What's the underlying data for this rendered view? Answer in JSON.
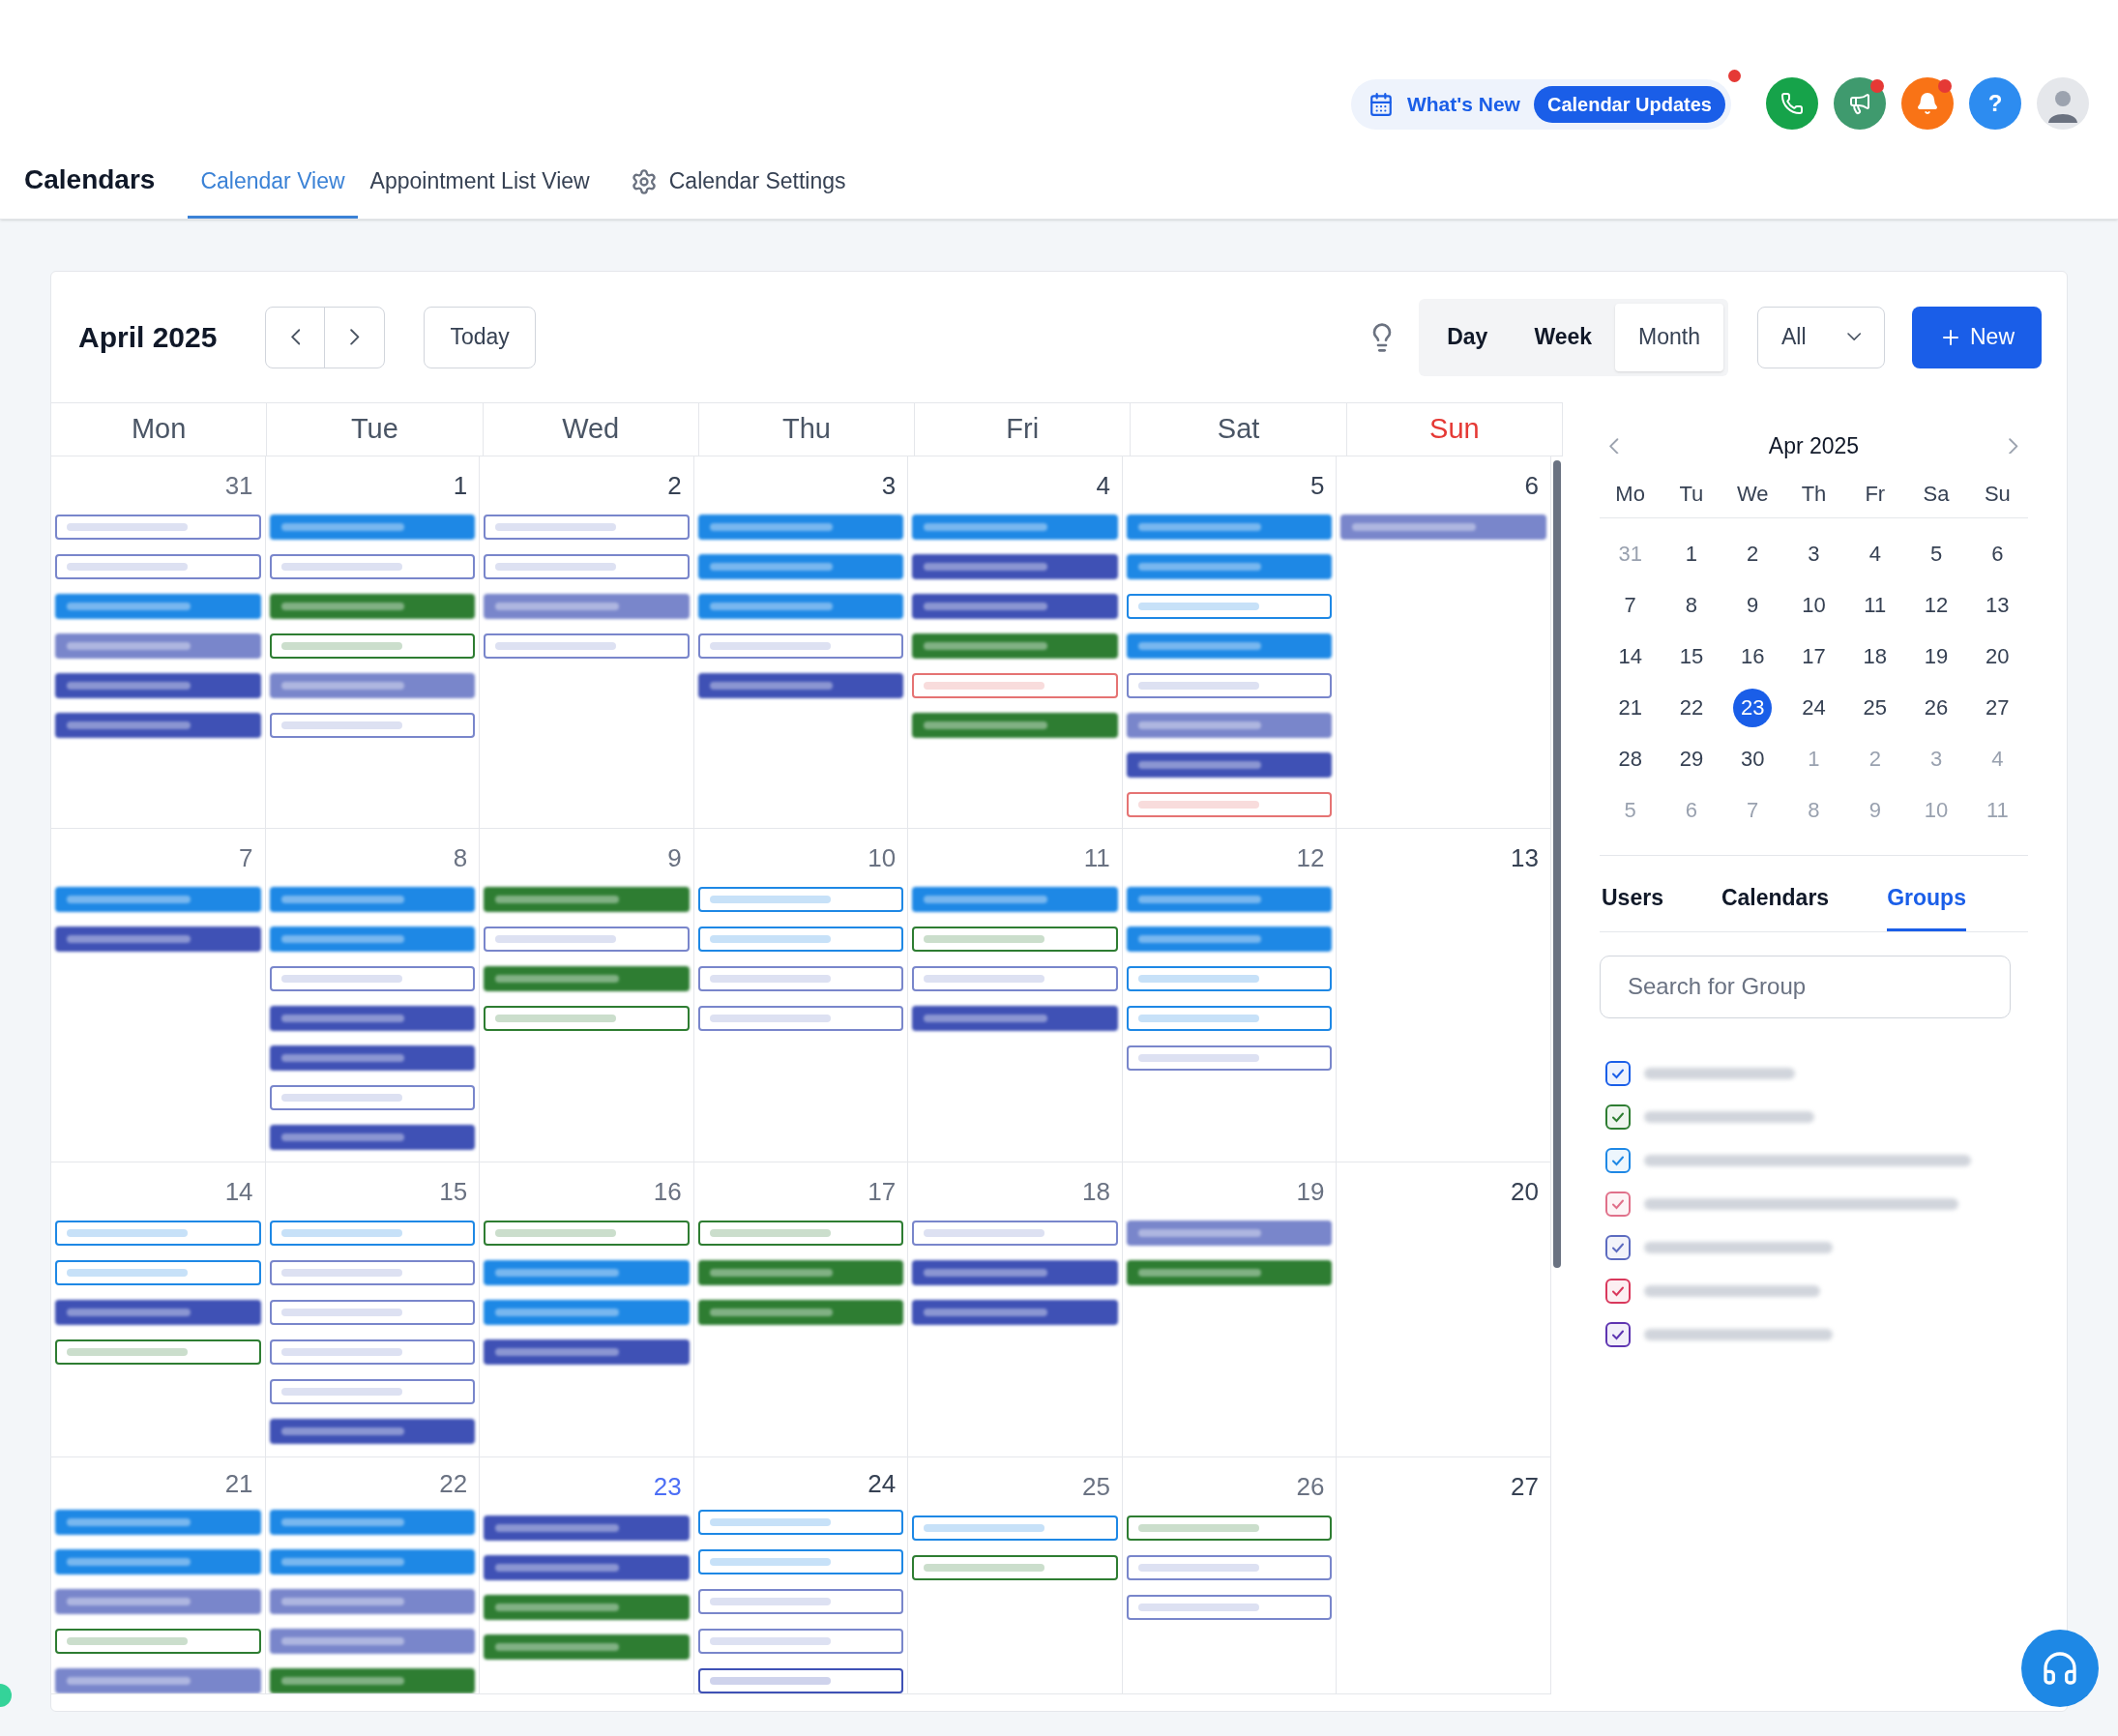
{
  "header": {
    "whats_new": "What's New",
    "updates": {
      "label": "Calendar Updates",
      "unread": true
    },
    "icons": [
      {
        "kind": "phone",
        "color": "#16a34a",
        "badge": false
      },
      {
        "kind": "megaphone",
        "color": "#3f9a6e",
        "badge": true
      },
      {
        "kind": "bell",
        "color": "#f97316",
        "badge": true
      },
      {
        "kind": "help",
        "color": "#2d8cf0",
        "badge": false,
        "text": "?"
      },
      {
        "kind": "avatar",
        "color": "#e5e7eb",
        "badge": false
      }
    ]
  },
  "page_title": "Calendars",
  "tabs": [
    {
      "label": "Calendar View",
      "selected": true,
      "kind": "text"
    },
    {
      "label": "Appointment List View",
      "selected": false,
      "kind": "text"
    },
    {
      "label": "Calendar Settings",
      "selected": false,
      "kind": "settings"
    }
  ],
  "toolbar": {
    "title": "April 2025",
    "today": "Today",
    "views": [
      {
        "label": "Day",
        "selected": false
      },
      {
        "label": "Week",
        "selected": false
      },
      {
        "label": "Month",
        "selected": true
      }
    ],
    "filter": "All",
    "new_button": "New"
  },
  "weekdays": [
    {
      "label": "Mon",
      "weekend": false
    },
    {
      "label": "Tue",
      "weekend": false
    },
    {
      "label": "Wed",
      "weekend": false
    },
    {
      "label": "Thu",
      "weekend": false
    },
    {
      "label": "Fri",
      "weekend": false
    },
    {
      "label": "Sat",
      "weekend": false
    },
    {
      "label": "Sun",
      "weekend": true
    }
  ],
  "weeks": [
    [
      {
        "day": "31",
        "kind": "muted",
        "events": [
          {
            "kind": "outline",
            "color": "#7986cb"
          },
          {
            "kind": "outline",
            "color": "#7986cb"
          },
          {
            "kind": "filled",
            "color": "#1e88e5"
          },
          {
            "kind": "filled",
            "color": "#7986cb"
          },
          {
            "kind": "filled",
            "color": "#3f51b5"
          },
          {
            "kind": "filled",
            "color": "#3f51b5"
          }
        ]
      },
      {
        "day": "1",
        "kind": "normal",
        "events": [
          {
            "kind": "filled",
            "color": "#1e88e5"
          },
          {
            "kind": "outline",
            "color": "#7986cb"
          },
          {
            "kind": "filled",
            "color": "#2e7d32"
          },
          {
            "kind": "outline",
            "color": "#2e7d32"
          },
          {
            "kind": "filled",
            "color": "#7986cb"
          },
          {
            "kind": "outline",
            "color": "#7986cb"
          }
        ]
      },
      {
        "day": "2",
        "kind": "normal",
        "events": [
          {
            "kind": "outline",
            "color": "#7986cb"
          },
          {
            "kind": "outline",
            "color": "#7986cb"
          },
          {
            "kind": "filled",
            "color": "#7986cb"
          },
          {
            "kind": "outline",
            "color": "#7986cb"
          }
        ]
      },
      {
        "day": "3",
        "kind": "normal",
        "events": [
          {
            "kind": "filled",
            "color": "#1e88e5"
          },
          {
            "kind": "filled",
            "color": "#1e88e5"
          },
          {
            "kind": "filled",
            "color": "#1e88e5"
          },
          {
            "kind": "outline",
            "color": "#7986cb"
          },
          {
            "kind": "filled",
            "color": "#3f51b5"
          }
        ]
      },
      {
        "day": "4",
        "kind": "normal",
        "events": [
          {
            "kind": "filled",
            "color": "#1e88e5"
          },
          {
            "kind": "filled",
            "color": "#3f51b5"
          },
          {
            "kind": "filled",
            "color": "#3f51b5"
          },
          {
            "kind": "filled",
            "color": "#2e7d32"
          },
          {
            "kind": "outline",
            "color": "#e57373"
          },
          {
            "kind": "filled",
            "color": "#2e7d32"
          }
        ]
      },
      {
        "day": "5",
        "kind": "normal",
        "events": [
          {
            "kind": "filled",
            "color": "#1e88e5"
          },
          {
            "kind": "filled",
            "color": "#1e88e5"
          },
          {
            "kind": "outline",
            "color": "#1e88e5"
          },
          {
            "kind": "filled",
            "color": "#1e88e5"
          },
          {
            "kind": "outline",
            "color": "#7986cb"
          },
          {
            "kind": "filled",
            "color": "#7986cb"
          },
          {
            "kind": "filled",
            "color": "#3f51b5"
          },
          {
            "kind": "outline",
            "color": "#e57373"
          }
        ]
      },
      {
        "day": "6",
        "kind": "normal",
        "events": [
          {
            "kind": "filled",
            "color": "#7986cb"
          }
        ]
      }
    ],
    [
      {
        "day": "7",
        "kind": "muted",
        "events": [
          {
            "kind": "filled",
            "color": "#1e88e5"
          },
          {
            "kind": "filled",
            "color": "#3f51b5"
          }
        ]
      },
      {
        "day": "8",
        "kind": "muted",
        "events": [
          {
            "kind": "filled",
            "color": "#1e88e5"
          },
          {
            "kind": "filled",
            "color": "#1e88e5"
          },
          {
            "kind": "outline",
            "color": "#7986cb"
          },
          {
            "kind": "filled",
            "color": "#3f51b5"
          },
          {
            "kind": "filled",
            "color": "#3f51b5"
          },
          {
            "kind": "outline",
            "color": "#7986cb"
          },
          {
            "kind": "filled",
            "color": "#3f51b5"
          }
        ]
      },
      {
        "day": "9",
        "kind": "muted",
        "events": [
          {
            "kind": "filled",
            "color": "#2e7d32"
          },
          {
            "kind": "outline",
            "color": "#7986cb"
          },
          {
            "kind": "filled",
            "color": "#2e7d32"
          },
          {
            "kind": "outline",
            "color": "#2e7d32"
          }
        ]
      },
      {
        "day": "10",
        "kind": "muted",
        "events": [
          {
            "kind": "outline",
            "color": "#1e88e5"
          },
          {
            "kind": "outline",
            "color": "#1e88e5"
          },
          {
            "kind": "outline",
            "color": "#7986cb"
          },
          {
            "kind": "outline",
            "color": "#7986cb"
          }
        ]
      },
      {
        "day": "11",
        "kind": "muted",
        "events": [
          {
            "kind": "filled",
            "color": "#1e88e5"
          },
          {
            "kind": "outline",
            "color": "#2e7d32"
          },
          {
            "kind": "outline",
            "color": "#7986cb"
          },
          {
            "kind": "filled",
            "color": "#3f51b5"
          }
        ]
      },
      {
        "day": "12",
        "kind": "muted",
        "events": [
          {
            "kind": "filled",
            "color": "#1e88e5"
          },
          {
            "kind": "filled",
            "color": "#1e88e5"
          },
          {
            "kind": "outline",
            "color": "#1e88e5"
          },
          {
            "kind": "outline",
            "color": "#1e88e5"
          },
          {
            "kind": "outline",
            "color": "#7986cb"
          }
        ]
      },
      {
        "day": "13",
        "kind": "normal"
      }
    ],
    [
      {
        "day": "14",
        "kind": "muted",
        "events": [
          {
            "kind": "outline",
            "color": "#1e88e5"
          },
          {
            "kind": "outline",
            "color": "#1e88e5"
          },
          {
            "kind": "filled",
            "color": "#3f51b5"
          },
          {
            "kind": "outline",
            "color": "#2e7d32"
          }
        ]
      },
      {
        "day": "15",
        "kind": "muted",
        "events": [
          {
            "kind": "outline",
            "color": "#1e88e5"
          },
          {
            "kind": "outline",
            "color": "#7986cb"
          },
          {
            "kind": "outline",
            "color": "#7986cb"
          },
          {
            "kind": "outline",
            "color": "#7986cb"
          },
          {
            "kind": "outline",
            "color": "#7986cb"
          },
          {
            "kind": "filled",
            "color": "#3f51b5"
          }
        ]
      },
      {
        "day": "16",
        "kind": "muted",
        "events": [
          {
            "kind": "outline",
            "color": "#2e7d32"
          },
          {
            "kind": "filled",
            "color": "#1e88e5"
          },
          {
            "kind": "filled",
            "color": "#1e88e5"
          },
          {
            "kind": "filled",
            "color": "#3f51b5"
          }
        ]
      },
      {
        "day": "17",
        "kind": "muted",
        "events": [
          {
            "kind": "outline",
            "color": "#2e7d32"
          },
          {
            "kind": "filled",
            "color": "#2e7d32"
          },
          {
            "kind": "filled",
            "color": "#2e7d32"
          }
        ]
      },
      {
        "day": "18",
        "kind": "muted",
        "events": [
          {
            "kind": "outline",
            "color": "#7986cb"
          },
          {
            "kind": "filled",
            "color": "#3f51b5"
          },
          {
            "kind": "filled",
            "color": "#3f51b5"
          }
        ]
      },
      {
        "day": "19",
        "kind": "muted",
        "events": [
          {
            "kind": "filled",
            "color": "#7986cb"
          },
          {
            "kind": "filled",
            "color": "#2e7d32"
          }
        ]
      },
      {
        "day": "20",
        "kind": "normal"
      }
    ],
    [
      {
        "day": "21",
        "kind": "muted",
        "events": [
          {
            "kind": "filled",
            "color": "#1e88e5"
          },
          {
            "kind": "filled",
            "color": "#1e88e5"
          },
          {
            "kind": "filled",
            "color": "#7986cb"
          },
          {
            "kind": "outline",
            "color": "#2e7d32"
          },
          {
            "kind": "filled",
            "color": "#7986cb"
          }
        ]
      },
      {
        "day": "22",
        "kind": "muted",
        "events": [
          {
            "kind": "filled",
            "color": "#1e88e5"
          },
          {
            "kind": "filled",
            "color": "#1e88e5"
          },
          {
            "kind": "filled",
            "color": "#7986cb"
          },
          {
            "kind": "filled",
            "color": "#7986cb"
          },
          {
            "kind": "filled",
            "color": "#2e7d32"
          }
        ]
      },
      {
        "day": "23",
        "kind": "today",
        "events": [
          {
            "kind": "filled",
            "color": "#3f51b5"
          },
          {
            "kind": "filled",
            "color": "#3f51b5"
          },
          {
            "kind": "filled",
            "color": "#2e7d32"
          },
          {
            "kind": "filled",
            "color": "#2e7d32"
          }
        ]
      },
      {
        "day": "24",
        "kind": "normal",
        "events": [
          {
            "kind": "outline",
            "color": "#1e88e5"
          },
          {
            "kind": "outline",
            "color": "#1e88e5"
          },
          {
            "kind": "outline",
            "color": "#7986cb"
          },
          {
            "kind": "outline",
            "color": "#7986cb"
          },
          {
            "kind": "outline",
            "color": "#3f51b5"
          }
        ]
      },
      {
        "day": "25",
        "kind": "muted",
        "events": [
          {
            "kind": "outline",
            "color": "#1e88e5"
          },
          {
            "kind": "outline",
            "color": "#2e7d32"
          }
        ]
      },
      {
        "day": "26",
        "kind": "muted",
        "events": [
          {
            "kind": "outline",
            "color": "#2e7d32"
          },
          {
            "kind": "outline",
            "color": "#7986cb"
          },
          {
            "kind": "outline",
            "color": "#7986cb"
          }
        ]
      },
      {
        "day": "27",
        "kind": "normal"
      }
    ]
  ],
  "mini_calendar": {
    "title": "Apr 2025",
    "weekdays": [
      "Mo",
      "Tu",
      "We",
      "Th",
      "Fr",
      "Sa",
      "Su"
    ],
    "weeks": [
      [
        {
          "label": "31",
          "kind": "other"
        },
        {
          "label": "1",
          "kind": "day"
        },
        {
          "label": "2",
          "kind": "day"
        },
        {
          "label": "3",
          "kind": "day"
        },
        {
          "label": "4",
          "kind": "day"
        },
        {
          "label": "5",
          "kind": "day"
        },
        {
          "label": "6",
          "kind": "day"
        }
      ],
      [
        {
          "label": "7",
          "kind": "day"
        },
        {
          "label": "8",
          "kind": "day"
        },
        {
          "label": "9",
          "kind": "day"
        },
        {
          "label": "10",
          "kind": "day"
        },
        {
          "label": "11",
          "kind": "day"
        },
        {
          "label": "12",
          "kind": "day"
        },
        {
          "label": "13",
          "kind": "day"
        }
      ],
      [
        {
          "label": "14",
          "kind": "day"
        },
        {
          "label": "15",
          "kind": "day"
        },
        {
          "label": "16",
          "kind": "day"
        },
        {
          "label": "17",
          "kind": "day"
        },
        {
          "label": "18",
          "kind": "day"
        },
        {
          "label": "19",
          "kind": "day"
        },
        {
          "label": "20",
          "kind": "day"
        }
      ],
      [
        {
          "label": "21",
          "kind": "day"
        },
        {
          "label": "22",
          "kind": "day"
        },
        {
          "label": "23",
          "kind": "today"
        },
        {
          "label": "24",
          "kind": "day"
        },
        {
          "label": "25",
          "kind": "day"
        },
        {
          "label": "26",
          "kind": "day"
        },
        {
          "label": "27",
          "kind": "day"
        }
      ],
      [
        {
          "label": "28",
          "kind": "day"
        },
        {
          "label": "29",
          "kind": "day"
        },
        {
          "label": "30",
          "kind": "day"
        },
        {
          "label": "1",
          "kind": "other"
        },
        {
          "label": "2",
          "kind": "other"
        },
        {
          "label": "3",
          "kind": "other"
        },
        {
          "label": "4",
          "kind": "other"
        }
      ],
      [
        {
          "label": "5",
          "kind": "other"
        },
        {
          "label": "6",
          "kind": "other"
        },
        {
          "label": "7",
          "kind": "other"
        },
        {
          "label": "8",
          "kind": "other"
        },
        {
          "label": "9",
          "kind": "other"
        },
        {
          "label": "10",
          "kind": "other"
        },
        {
          "label": "11",
          "kind": "other"
        }
      ]
    ]
  },
  "side_tabs": [
    {
      "label": "Users",
      "selected": false
    },
    {
      "label": "Calendars",
      "selected": false
    },
    {
      "label": "Groups",
      "selected": true
    }
  ],
  "group_search": {
    "placeholder": "Search for Group"
  },
  "groups": [
    {
      "checked": true,
      "color": "#1a5ee8"
    },
    {
      "checked": true,
      "color": "#2e7d32"
    },
    {
      "checked": true,
      "color": "#1e88e5"
    },
    {
      "checked": true,
      "color": "#e0708a"
    },
    {
      "checked": true,
      "color": "#5c6bc0"
    },
    {
      "checked": true,
      "color": "#d9385c"
    },
    {
      "checked": true,
      "color": "#5e35b1"
    }
  ]
}
